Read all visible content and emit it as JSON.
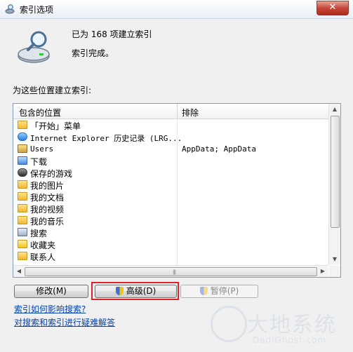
{
  "window": {
    "title": "索引选项",
    "close_glyph": "✕"
  },
  "status": {
    "count_text": "已为 168 项建立索引",
    "state_text": "索引完成。"
  },
  "section_label": "为这些位置建立索引:",
  "table": {
    "columns": [
      "包含的位置",
      "排除"
    ],
    "rows": [
      {
        "name": "「开始」菜单",
        "exclude": "",
        "icon": "folder-icon"
      },
      {
        "name": "Internet Explorer 历史记录 (LRG...",
        "exclude": "",
        "icon": "internet-explorer-icon"
      },
      {
        "name": "Users",
        "exclude": "AppData; AppData",
        "icon": "users-folder-icon"
      },
      {
        "name": "下载",
        "exclude": "",
        "icon": "downloads-folder-icon"
      },
      {
        "name": "保存的游戏",
        "exclude": "",
        "icon": "saved-games-icon"
      },
      {
        "name": "我的图片",
        "exclude": "",
        "icon": "folder-icon"
      },
      {
        "name": "我的文档",
        "exclude": "",
        "icon": "folder-icon"
      },
      {
        "name": "我的视频",
        "exclude": "",
        "icon": "folder-icon"
      },
      {
        "name": "我的音乐",
        "exclude": "",
        "icon": "folder-icon"
      },
      {
        "name": "搜索",
        "exclude": "",
        "icon": "searches-folder-icon"
      },
      {
        "name": "收藏夹",
        "exclude": "",
        "icon": "favorites-folder-icon"
      },
      {
        "name": "联系人",
        "exclude": "",
        "icon": "folder-icon"
      }
    ]
  },
  "buttons": {
    "modify": "修改(M)",
    "advanced": "高级(D)",
    "pause": "暂停(P)"
  },
  "links": {
    "how_indexing_affects": "索引如何影响搜索?",
    "troubleshoot": "对搜索和索引进行疑难解答"
  },
  "scrollbar_glyphs": {
    "up": "▲",
    "down": "▼",
    "left": "◀",
    "right": "▶",
    "grip": "|||"
  },
  "watermark": {
    "cn": "大地系统",
    "en": "DadiGhost.com"
  },
  "colors": {
    "highlight": "#d9242a",
    "link": "#0645ad",
    "close_button": "#c6473a"
  }
}
